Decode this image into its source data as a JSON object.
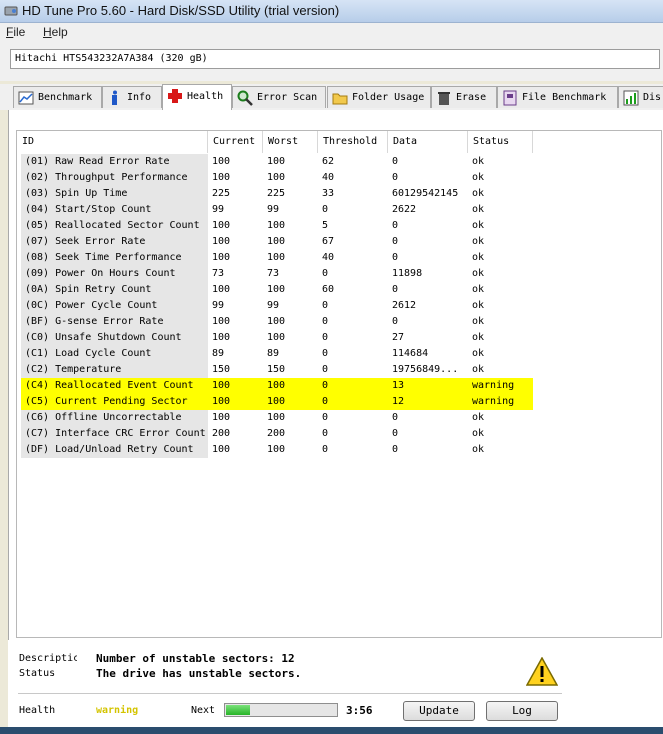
{
  "window": {
    "title": "HD Tune Pro 5.60 - Hard Disk/SSD Utility (trial version)"
  },
  "menu": {
    "file": {
      "first": "F",
      "rest": "ile"
    },
    "help": {
      "first": "H",
      "rest": "elp"
    }
  },
  "drive": {
    "selected": "Hitachi HTS543232A7A384 (320 gB)"
  },
  "tabs": [
    {
      "label": "Benchmark",
      "icon": "benchmark-icon"
    },
    {
      "label": "Info",
      "icon": "info-icon"
    },
    {
      "label": "Health",
      "icon": "health-cross-icon"
    },
    {
      "label": "Error Scan",
      "icon": "magnifier-icon"
    },
    {
      "label": "Folder Usage",
      "icon": "folder-icon"
    },
    {
      "label": "Erase",
      "icon": "trash-icon"
    },
    {
      "label": "File Benchmark",
      "icon": "file-benchmark-icon"
    },
    {
      "label": "Dis",
      "icon": "chart-icon"
    }
  ],
  "table": {
    "headers": {
      "id": "ID",
      "current": "Current",
      "worst": "Worst",
      "threshold": "Threshold",
      "data": "Data",
      "status": "Status"
    },
    "rows": [
      {
        "id": "(01) Raw Read Error Rate",
        "current": "100",
        "worst": "100",
        "threshold": "62",
        "data": "0",
        "status": "ok"
      },
      {
        "id": "(02) Throughput Performance",
        "current": "100",
        "worst": "100",
        "threshold": "40",
        "data": "0",
        "status": "ok"
      },
      {
        "id": "(03) Spin Up Time",
        "current": "225",
        "worst": "225",
        "threshold": "33",
        "data": "60129542145",
        "status": "ok"
      },
      {
        "id": "(04) Start/Stop Count",
        "current": "99",
        "worst": "99",
        "threshold": "0",
        "data": "2622",
        "status": "ok"
      },
      {
        "id": "(05) Reallocated Sector Count",
        "current": "100",
        "worst": "100",
        "threshold": "5",
        "data": "0",
        "status": "ok"
      },
      {
        "id": "(07) Seek Error Rate",
        "current": "100",
        "worst": "100",
        "threshold": "67",
        "data": "0",
        "status": "ok"
      },
      {
        "id": "(08) Seek Time Performance",
        "current": "100",
        "worst": "100",
        "threshold": "40",
        "data": "0",
        "status": "ok"
      },
      {
        "id": "(09) Power On Hours Count",
        "current": "73",
        "worst": "73",
        "threshold": "0",
        "data": "11898",
        "status": "ok"
      },
      {
        "id": "(0A) Spin Retry Count",
        "current": "100",
        "worst": "100",
        "threshold": "60",
        "data": "0",
        "status": "ok"
      },
      {
        "id": "(0C) Power Cycle Count",
        "current": "99",
        "worst": "99",
        "threshold": "0",
        "data": "2612",
        "status": "ok"
      },
      {
        "id": "(BF) G-sense Error Rate",
        "current": "100",
        "worst": "100",
        "threshold": "0",
        "data": "0",
        "status": "ok"
      },
      {
        "id": "(C0) Unsafe Shutdown Count",
        "current": "100",
        "worst": "100",
        "threshold": "0",
        "data": "27",
        "status": "ok"
      },
      {
        "id": "(C1) Load Cycle Count",
        "current": "89",
        "worst": "89",
        "threshold": "0",
        "data": "114684",
        "status": "ok"
      },
      {
        "id": "(C2) Temperature",
        "current": "150",
        "worst": "150",
        "threshold": "0",
        "data": "19756849...",
        "status": "ok"
      },
      {
        "id": "(C4) Reallocated Event Count",
        "current": "100",
        "worst": "100",
        "threshold": "0",
        "data": "13",
        "status": "warning"
      },
      {
        "id": "(C5) Current Pending Sector",
        "current": "100",
        "worst": "100",
        "threshold": "0",
        "data": "12",
        "status": "warning"
      },
      {
        "id": "(C6) Offline Uncorrectable",
        "current": "100",
        "worst": "100",
        "threshold": "0",
        "data": "0",
        "status": "ok"
      },
      {
        "id": "(C7) Interface CRC Error Count",
        "current": "200",
        "worst": "200",
        "threshold": "0",
        "data": "0",
        "status": "ok"
      },
      {
        "id": "(DF) Load/Unload Retry Count",
        "current": "100",
        "worst": "100",
        "threshold": "0",
        "data": "0",
        "status": "ok"
      }
    ]
  },
  "details": {
    "description_label": "Descriptic",
    "description_value": "Number of unstable sectors: 12",
    "status_label": "Status",
    "status_value": "The drive has unstable sectors."
  },
  "footer": {
    "health_label": "Health",
    "health_value": "warning",
    "next_label": "Next",
    "progress": 0.22,
    "time": "3:56",
    "update_button": "Update",
    "log_button": "Log"
  },
  "colors": {
    "warning_row": "#ffff00",
    "warning_text": "#d4c400",
    "progress": "#27b427"
  }
}
